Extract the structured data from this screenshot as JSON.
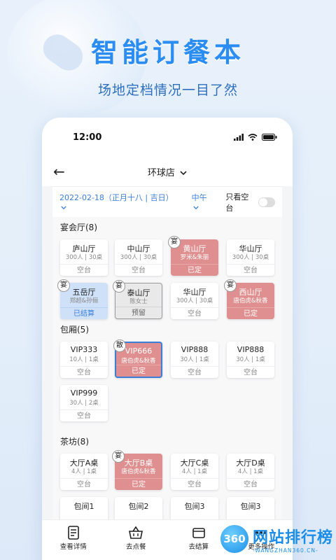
{
  "promo": {
    "headline": "智能订餐本",
    "subline": "场地定档情况一目了然"
  },
  "status_bar": {
    "time": "12:00"
  },
  "nav": {
    "back_icon": "←",
    "store_name": "环球店",
    "dropdown_icon": "chevron-down-icon"
  },
  "filter": {
    "date": "2022-02-18（正月十八 | 吉日）",
    "meal": "中午",
    "only_empty_label": "只看空台",
    "only_empty_on": false
  },
  "sections": [
    {
      "title": "宴会厅(8)",
      "cards": [
        {
          "name": "庐山厅",
          "sub": "300人 | 30桌",
          "status": "空台",
          "state": "empty",
          "tag": ""
        },
        {
          "name": "中山厅",
          "sub": "300人 | 30桌",
          "status": "空台",
          "state": "empty",
          "tag": ""
        },
        {
          "name": "黄山厅",
          "sub": "罗米&朱丽",
          "status": "已定",
          "state": "booked",
          "tag": "宴"
        },
        {
          "name": "华山厅",
          "sub": "300人 | 30桌",
          "status": "空台",
          "state": "empty",
          "tag": ""
        },
        {
          "name": "五岳厅",
          "sub": "郑超&孙俪",
          "status": "已结算",
          "state": "settled",
          "tag": "宴"
        },
        {
          "name": "泰山厅",
          "sub": "陈女士",
          "status": "预留",
          "state": "reserved",
          "tag": "宴"
        },
        {
          "name": "华山厅",
          "sub": "300人 | 30桌",
          "status": "空台",
          "state": "empty",
          "tag": ""
        },
        {
          "name": "西山厅",
          "sub": "唐伯虎&秋香",
          "status": "已定",
          "state": "booked",
          "tag": "宴"
        }
      ]
    },
    {
      "title": "包厢(5)",
      "cards": [
        {
          "name": "VIP333",
          "sub": "10人 | 1桌",
          "status": "空台",
          "state": "empty",
          "tag": ""
        },
        {
          "name": "VIP666",
          "sub": "唐伯虎&秋香",
          "status": "已定",
          "state": "booked selected",
          "tag": "散"
        },
        {
          "name": "VIP888",
          "sub": "30人 | 1桌",
          "status": "空台",
          "state": "empty",
          "tag": ""
        },
        {
          "name": "VIP888",
          "sub": "30人 | 1桌",
          "status": "空台",
          "state": "empty",
          "tag": ""
        },
        {
          "name": "VIP999",
          "sub": "30人 | 2桌",
          "status": "空台",
          "state": "empty",
          "tag": ""
        }
      ]
    },
    {
      "title": "茶坊(8)",
      "cards": [
        {
          "name": "大厅A桌",
          "sub": "4人 | 1桌",
          "status": "空台",
          "state": "empty",
          "tag": ""
        },
        {
          "name": "大厅B桌",
          "sub": "唐伯虎&秋香",
          "status": "已定",
          "state": "booked",
          "tag": "宴"
        },
        {
          "name": "大厅C桌",
          "sub": "4人 | 1桌",
          "status": "空台",
          "state": "empty",
          "tag": ""
        },
        {
          "name": "大厅D桌",
          "sub": "4人 | 1桌",
          "status": "空台",
          "state": "empty",
          "tag": ""
        },
        {
          "name": "包间1",
          "sub": "",
          "status": "",
          "state": "empty",
          "tag": ""
        },
        {
          "name": "包间2",
          "sub": "",
          "status": "",
          "state": "empty",
          "tag": ""
        },
        {
          "name": "包间3",
          "sub": "",
          "status": "",
          "state": "empty",
          "tag": ""
        },
        {
          "name": "包间3",
          "sub": "",
          "status": "",
          "state": "empty",
          "tag": ""
        }
      ]
    }
  ],
  "bottom_bar": [
    {
      "label": "查看详情",
      "icon": "document-icon"
    },
    {
      "label": "去点餐",
      "icon": "basket-icon"
    },
    {
      "label": "去结算",
      "icon": "wallet-icon"
    },
    {
      "label": "更多操作",
      "icon": "more-icon"
    }
  ],
  "watermark": {
    "logo": "360",
    "cn": "网站排行榜",
    "en": "-WANGZHAN360.CN-"
  },
  "colors": {
    "accent": "#3b7ed8",
    "booked": "#df8f8f",
    "settled": "#cfe1f8",
    "headline": "#2b8cf2"
  }
}
